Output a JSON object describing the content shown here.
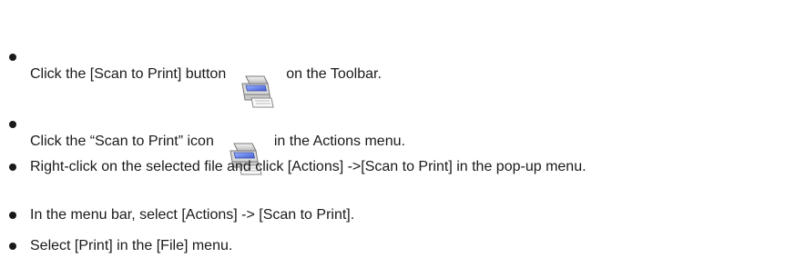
{
  "instructions": [
    {
      "before": "Click the [Scan to Print] button",
      "icon": "scan-to-print-icon",
      "after": "on the Toolbar."
    },
    {
      "before": "Click the “Scan to Print” icon",
      "icon": "scan-to-print-icon",
      "after": "in the Actions menu."
    },
    {
      "text": "Right-click on the selected file and click [Actions] ->[Scan to Print] in the pop-up menu."
    },
    {
      "text": "In the menu bar, select [Actions] -> [Scan to Print]."
    },
    {
      "text": "Select [Print] in the [File] menu."
    }
  ]
}
